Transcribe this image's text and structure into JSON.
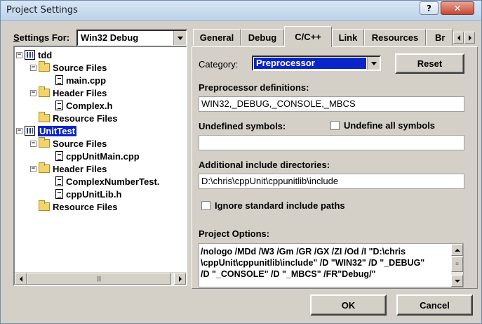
{
  "window": {
    "title": "Project Settings",
    "help_label": "?",
    "close_label": "✕"
  },
  "settings_for": {
    "label_prefix": "S",
    "label_rest": "ettings For:",
    "value": "Win32 Debug"
  },
  "tree": {
    "items": [
      {
        "label": "tdd",
        "type": "project",
        "expander": "−"
      },
      {
        "label": "Source Files",
        "type": "folder",
        "expander": "−"
      },
      {
        "label": "main.cpp",
        "type": "file"
      },
      {
        "label": "Header Files",
        "type": "folder",
        "expander": "−"
      },
      {
        "label": "Complex.h",
        "type": "file"
      },
      {
        "label": "Resource Files",
        "type": "folder"
      },
      {
        "label": "UnitTest",
        "type": "project",
        "expander": "−",
        "selected": true
      },
      {
        "label": "Source Files",
        "type": "folder",
        "expander": "−"
      },
      {
        "label": "cppUnitMain.cpp",
        "type": "file"
      },
      {
        "label": "Header Files",
        "type": "folder",
        "expander": "−"
      },
      {
        "label": "ComplexNumberTest.",
        "type": "file"
      },
      {
        "label": "cppUnitLib.h",
        "type": "file"
      },
      {
        "label": "Resource Files",
        "type": "folder"
      }
    ]
  },
  "tabs": [
    "General",
    "Debug",
    "C/C++",
    "Link",
    "Resources",
    "Br"
  ],
  "active_tab": "C/C++",
  "panel": {
    "category_label": "Category:",
    "category_value": "Preprocessor",
    "reset_label": "Reset",
    "preprocessor_label": "Preprocessor definitions:",
    "preprocessor_value": "WIN32,_DEBUG,_CONSOLE,_MBCS",
    "undefined_label": "Undefined symbols:",
    "undefined_value": "",
    "undefine_all_label": "Undefine all symbols",
    "include_label": "Additional include directories:",
    "include_value": "D:\\chris\\cppUnit\\cppunitlib\\include",
    "ignore_label": "Ignore standard include paths",
    "options_label": "Project Options:",
    "options_lines": [
      "/nologo /MDd /W3 /Gm /GR /GX /ZI /Od /I \"D:\\chris",
      "\\cppUnit\\cppunitlib\\include\" /D \"WIN32\" /D \"_DEBUG\"",
      "/D \"_CONSOLE\" /D \"_MBCS\" /FR\"Debug/\""
    ]
  },
  "footer": {
    "ok_label": "OK",
    "cancel_label": "Cancel"
  },
  "colors": {
    "selection": "#0a24c8",
    "dialog_face": "#d4d0c8"
  }
}
